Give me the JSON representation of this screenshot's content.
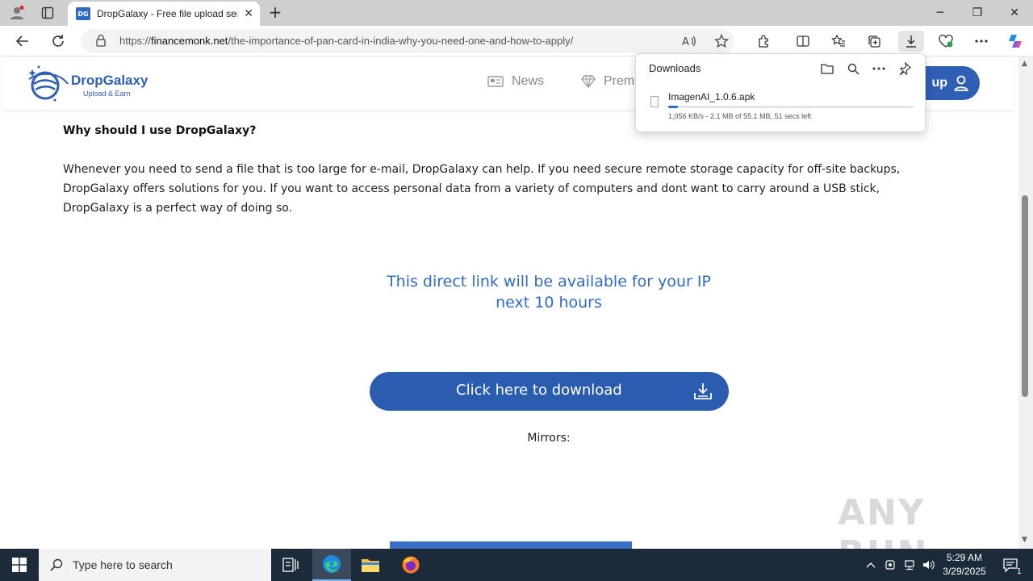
{
  "browser": {
    "tab": {
      "favicon_text": "DG",
      "title": "DropGalaxy - Free file upload service",
      "close": "✕"
    },
    "new_tab": "+",
    "window_controls": {
      "minimize": "─",
      "maximize": "❐",
      "close": "✕"
    },
    "address": {
      "scheme": "https://",
      "host": "financemonk.net",
      "path": "/the-importance-of-pan-card-in-india-why-you-need-one-and-how-to-apply/"
    }
  },
  "downloads": {
    "title": "Downloads",
    "items": [
      {
        "name": "ImagenAI_1.0.6.apk",
        "status": "1,056 KB/s - 2.1 MB of 55.1 MB, 51 secs left",
        "progress": 0.038
      }
    ]
  },
  "site": {
    "brand": "DropGalaxy",
    "tagline": "Upload & Earn",
    "nav": {
      "news": "News",
      "premium": "Prem"
    },
    "signup": "up"
  },
  "main": {
    "heading": "Why should I use DropGalaxy?",
    "paragraph": "Whenever you need to send a file that is too large for e-mail, DropGalaxy can help. If you need secure remote storage capacity for off-site backups, DropGalaxy offers solutions for you. If you want to access personal data from a variety of computers and dont want to carry around a USB stick, DropGalaxy is a perfect way of doing so.",
    "notice_line1": "This direct link will be available for your IP",
    "notice_line2": "next 10 hours",
    "download_button": "Click here to download",
    "mirrors": "Mirrors:"
  },
  "watermark": "ANY RUN",
  "taskbar": {
    "search_placeholder": "Type here to search",
    "time": "5:29 AM",
    "date": "3/29/2025",
    "notification_count": "1"
  },
  "colors": {
    "brand": "#2f5fb5",
    "button": "#2a5db0",
    "notice": "#2f6bc4",
    "taskbar": "#1c2b3a"
  }
}
